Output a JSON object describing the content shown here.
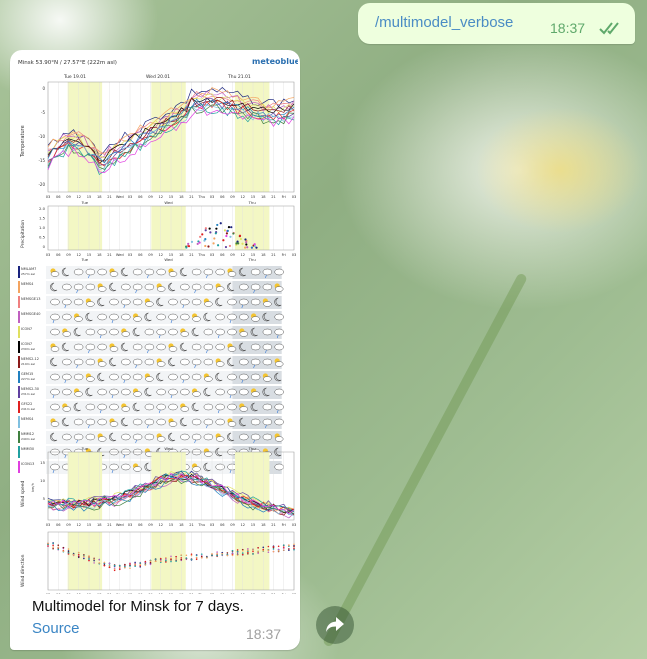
{
  "outgoing": {
    "text": "/multimodel_verbose",
    "time": "18:37",
    "status_icon": "double-check-icon"
  },
  "incoming": {
    "caption": "Multimodel for Minsk for 7 days.",
    "link": "Source",
    "time": "18:37"
  },
  "meteogram": {
    "header_location": "Minsk 53.90°N / 27.57°E (222m asl)",
    "brand": "meteoblue",
    "days": [
      "Tue 19.01",
      "Wed 20.01",
      "Thu 21.01"
    ],
    "day_short": [
      "Tue",
      "Wed",
      "Thu"
    ],
    "hour_ticks": [
      "03",
      "06",
      "09",
      "12",
      "15",
      "18",
      "21",
      "Wed",
      "03",
      "06",
      "09",
      "12",
      "15",
      "18",
      "21",
      "Thu",
      "03",
      "06",
      "09",
      "12",
      "15",
      "18",
      "21",
      "Fri",
      "03"
    ],
    "temperature_label": "Temperature",
    "precip_label": "Precipitation",
    "wind_speed_label": "Wind speed",
    "wind_dir_label": "Wind direction",
    "temp_ticks": [
      "0",
      "-5",
      "-10",
      "-15",
      "-20"
    ],
    "precip_ticks": [
      "2.0",
      "1.5",
      "1.0",
      "0.5",
      "0"
    ],
    "precip_unit": "mm",
    "wind_unit": "km/h",
    "wind_ticks": [
      "15",
      "10",
      "5"
    ],
    "models": [
      {
        "name": "NMLAM7",
        "alt": "257m asl",
        "color": "#1a237e"
      },
      {
        "name": "NEMS4",
        "alt": "",
        "color": "#f4a460"
      },
      {
        "name": "NEMSGE13",
        "alt": "",
        "color": "#f08080"
      },
      {
        "name": "NEMSGE40",
        "alt": "",
        "color": "#c060c0"
      },
      {
        "name": "ICON7",
        "alt": "",
        "color": "#e0e060"
      },
      {
        "name": "ICON7",
        "alt": "230m asl",
        "color": "#000000"
      },
      {
        "name": "NEMS2-12",
        "alt": "219m asl",
        "color": "#8b1a1a"
      },
      {
        "name": "GEM15",
        "alt": "227m asl",
        "color": "#2080c0"
      },
      {
        "name": "NEMS2-30",
        "alt": "231m asl",
        "color": "#6040a0"
      },
      {
        "name": "GFS22",
        "alt": "241m asl",
        "color": "#e02020"
      },
      {
        "name": "NEMS4",
        "alt": "",
        "color": "#80c0e0"
      },
      {
        "name": "NMM12",
        "alt": "240m asl",
        "color": "#408040"
      },
      {
        "name": "NMM30",
        "alt": "",
        "color": "#20a0a0"
      },
      {
        "name": "ICON13",
        "alt": "",
        "color": "#e040e0"
      }
    ]
  }
}
